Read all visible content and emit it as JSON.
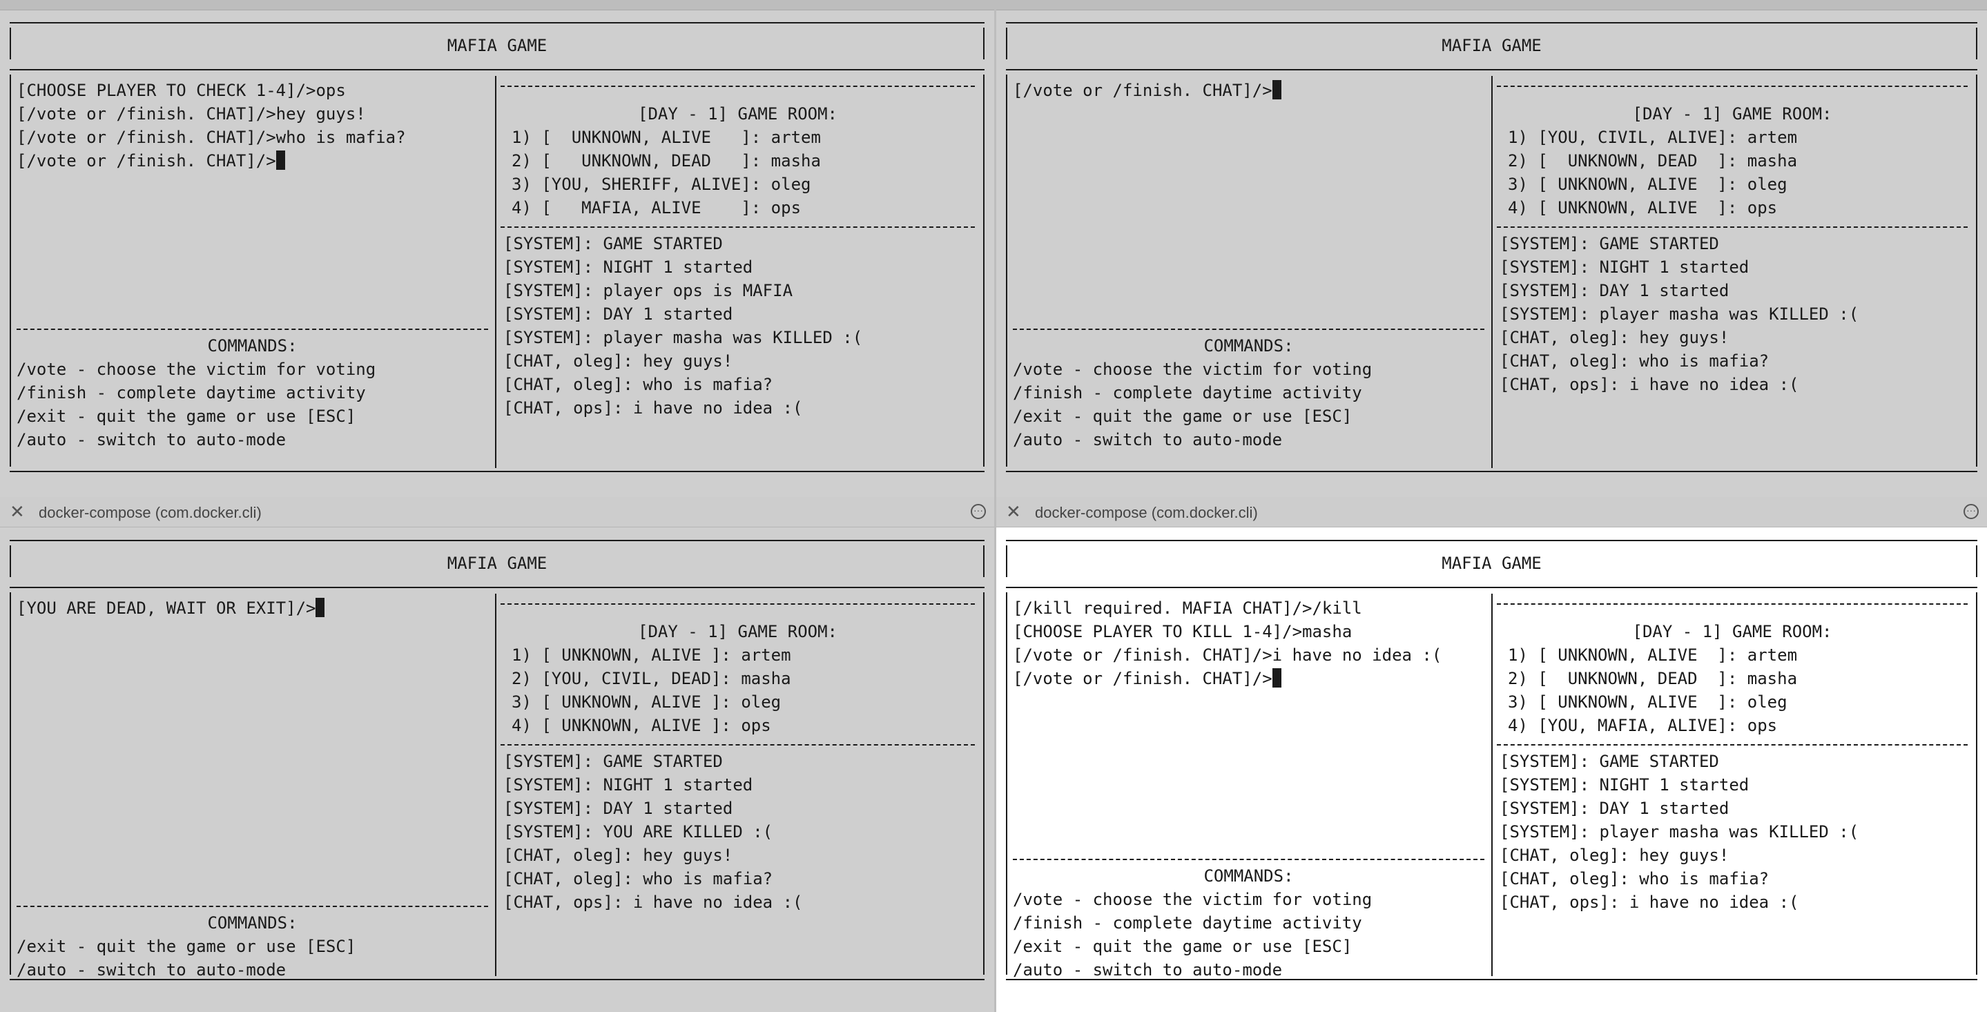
{
  "window_title": "docker-compose (com.docker.cli)",
  "game_title": "MAFIA GAME",
  "commands_header": "COMMANDS:",
  "room_header": "[DAY - 1] GAME ROOM:",
  "panes": [
    {
      "input_lines": [
        "[CHOOSE PLAYER TO CHECK 1-4]/>ops",
        "[/vote or /finish. CHAT]/>hey guys!",
        "[/vote or /finish. CHAT]/>who is mafia?",
        "[/vote or /finish. CHAT]/>"
      ],
      "commands": [
        "/vote - choose the victim for voting",
        "/finish - complete daytime activity",
        "/exit - quit the game or use [ESC]",
        "/auto - switch to auto-mode"
      ],
      "players": [
        "1) [  UNKNOWN, ALIVE   ]: artem",
        "2) [   UNKNOWN, DEAD   ]: masha",
        "3) [YOU, SHERIFF, ALIVE]: oleg",
        "4) [   MAFIA, ALIVE    ]: ops"
      ],
      "log": [
        "[SYSTEM]: GAME STARTED",
        "[SYSTEM]: NIGHT 1 started",
        "[SYSTEM]: player ops is MAFIA",
        "[SYSTEM]: DAY 1 started",
        "[SYSTEM]: player masha was KILLED :(",
        "[CHAT, oleg]: hey guys!",
        "[CHAT, oleg]: who is mafia?",
        "[CHAT, ops]: i have no idea :("
      ]
    },
    {
      "input_lines": [
        "[/vote or /finish. CHAT]/>"
      ],
      "commands": [
        "/vote - choose the victim for voting",
        "/finish - complete daytime activity",
        "/exit - quit the game or use [ESC]",
        "/auto - switch to auto-mode"
      ],
      "players": [
        "1) [YOU, CIVIL, ALIVE]: artem",
        "2) [  UNKNOWN, DEAD  ]: masha",
        "3) [ UNKNOWN, ALIVE  ]: oleg",
        "4) [ UNKNOWN, ALIVE  ]: ops"
      ],
      "log": [
        "[SYSTEM]: GAME STARTED",
        "[SYSTEM]: NIGHT 1 started",
        "[SYSTEM]: DAY 1 started",
        "[SYSTEM]: player masha was KILLED :(",
        "[CHAT, oleg]: hey guys!",
        "[CHAT, oleg]: who is mafia?",
        "[CHAT, ops]: i have no idea :("
      ]
    },
    {
      "input_lines": [
        "[YOU ARE DEAD, WAIT OR EXIT]/>"
      ],
      "commands": [
        "/exit - quit the game or use [ESC]",
        "/auto - switch to auto-mode"
      ],
      "players": [
        "1) [ UNKNOWN, ALIVE ]: artem",
        "2) [YOU, CIVIL, DEAD]: masha",
        "3) [ UNKNOWN, ALIVE ]: oleg",
        "4) [ UNKNOWN, ALIVE ]: ops"
      ],
      "log": [
        "[SYSTEM]: GAME STARTED",
        "[SYSTEM]: NIGHT 1 started",
        "[SYSTEM]: DAY 1 started",
        "[SYSTEM]: YOU ARE KILLED :(",
        "[CHAT, oleg]: hey guys!",
        "[CHAT, oleg]: who is mafia?",
        "[CHAT, ops]: i have no idea :("
      ]
    },
    {
      "input_lines": [
        "[/kill required. MAFIA CHAT]/>/kill",
        "[CHOOSE PLAYER TO KILL 1-4]/>masha",
        "[/vote or /finish. CHAT]/>i have no idea :(",
        "[/vote or /finish. CHAT]/>"
      ],
      "commands": [
        "/vote - choose the victim for voting",
        "/finish - complete daytime activity",
        "/exit - quit the game or use [ESC]",
        "/auto - switch to auto-mode"
      ],
      "players": [
        "1) [ UNKNOWN, ALIVE  ]: artem",
        "2) [  UNKNOWN, DEAD  ]: masha",
        "3) [ UNKNOWN, ALIVE  ]: oleg",
        "4) [YOU, MAFIA, ALIVE]: ops"
      ],
      "log": [
        "[SYSTEM]: GAME STARTED",
        "[SYSTEM]: NIGHT 1 started",
        "[SYSTEM]: DAY 1 started",
        "[SYSTEM]: player masha was KILLED :(",
        "[CHAT, oleg]: hey guys!",
        "[CHAT, oleg]: who is mafia?",
        "[CHAT, ops]: i have no idea :("
      ]
    }
  ],
  "colors": {
    "inactive_bg": "#cfcfcf",
    "active_bg": "#ffffff",
    "text": "#1a1a1a"
  }
}
